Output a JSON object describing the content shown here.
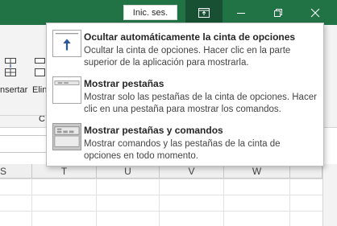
{
  "titlebar": {
    "signin_label": "Inic. ses.",
    "accent_color": "#217346",
    "icons": [
      "ribbon-display-options-icon",
      "minimize-icon",
      "restore-icon",
      "close-icon"
    ]
  },
  "ribbon": {
    "insert_label": "nsertar",
    "delete_label": "Elin",
    "group_label": "C"
  },
  "grid": {
    "columns": [
      "S",
      "T",
      "U",
      "V",
      "W"
    ]
  },
  "menu": {
    "items": [
      {
        "title": "Ocultar automáticamente la cinta de opciones",
        "description": "Ocultar la cinta de opciones. Hacer clic en la parte superior de la aplicación para mostrarla.",
        "icon": "autohide-ribbon-icon"
      },
      {
        "title": "Mostrar pestañas",
        "description": "Mostrar solo las pestañas de la cinta de opciones. Hacer clic en una pestaña para mostrar los comandos.",
        "icon": "show-tabs-icon"
      },
      {
        "title": "Mostrar pestañas y comandos",
        "description": "Mostrar comandos y las pestañas de la cinta de opciones en todo momento.",
        "icon": "show-tabs-and-commands-icon",
        "selected": true
      }
    ]
  }
}
